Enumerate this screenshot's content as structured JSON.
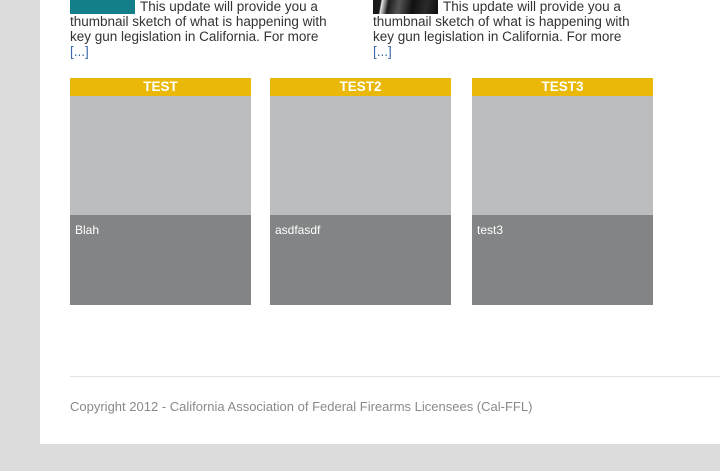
{
  "news": [
    {
      "text": "This update will provide you a thumbnail sketch of what is happening with key gun legislation in California. For more",
      "more_link": "[...]"
    },
    {
      "text": "This update will provide you a thumbnail sketch of what is happening with key gun legislation in California. For more",
      "more_link": "[...]"
    }
  ],
  "cards": [
    {
      "title": "TEST",
      "body": "Blah"
    },
    {
      "title": "TEST2",
      "body": "asdfasdf"
    },
    {
      "title": "TEST3",
      "body": "test3"
    }
  ],
  "footer": {
    "copyright": "Copyright 2012 - California Association of Federal Firearms Licensees (Cal-FFL)"
  },
  "colors": {
    "page_background": "#dcdcdc",
    "content_background": "#ffffff",
    "card_header": "#e9b808",
    "card_image": "#bcbdbf",
    "card_body": "#838485",
    "link": "#3a68a8",
    "thumb_teal": "#137f8a"
  }
}
